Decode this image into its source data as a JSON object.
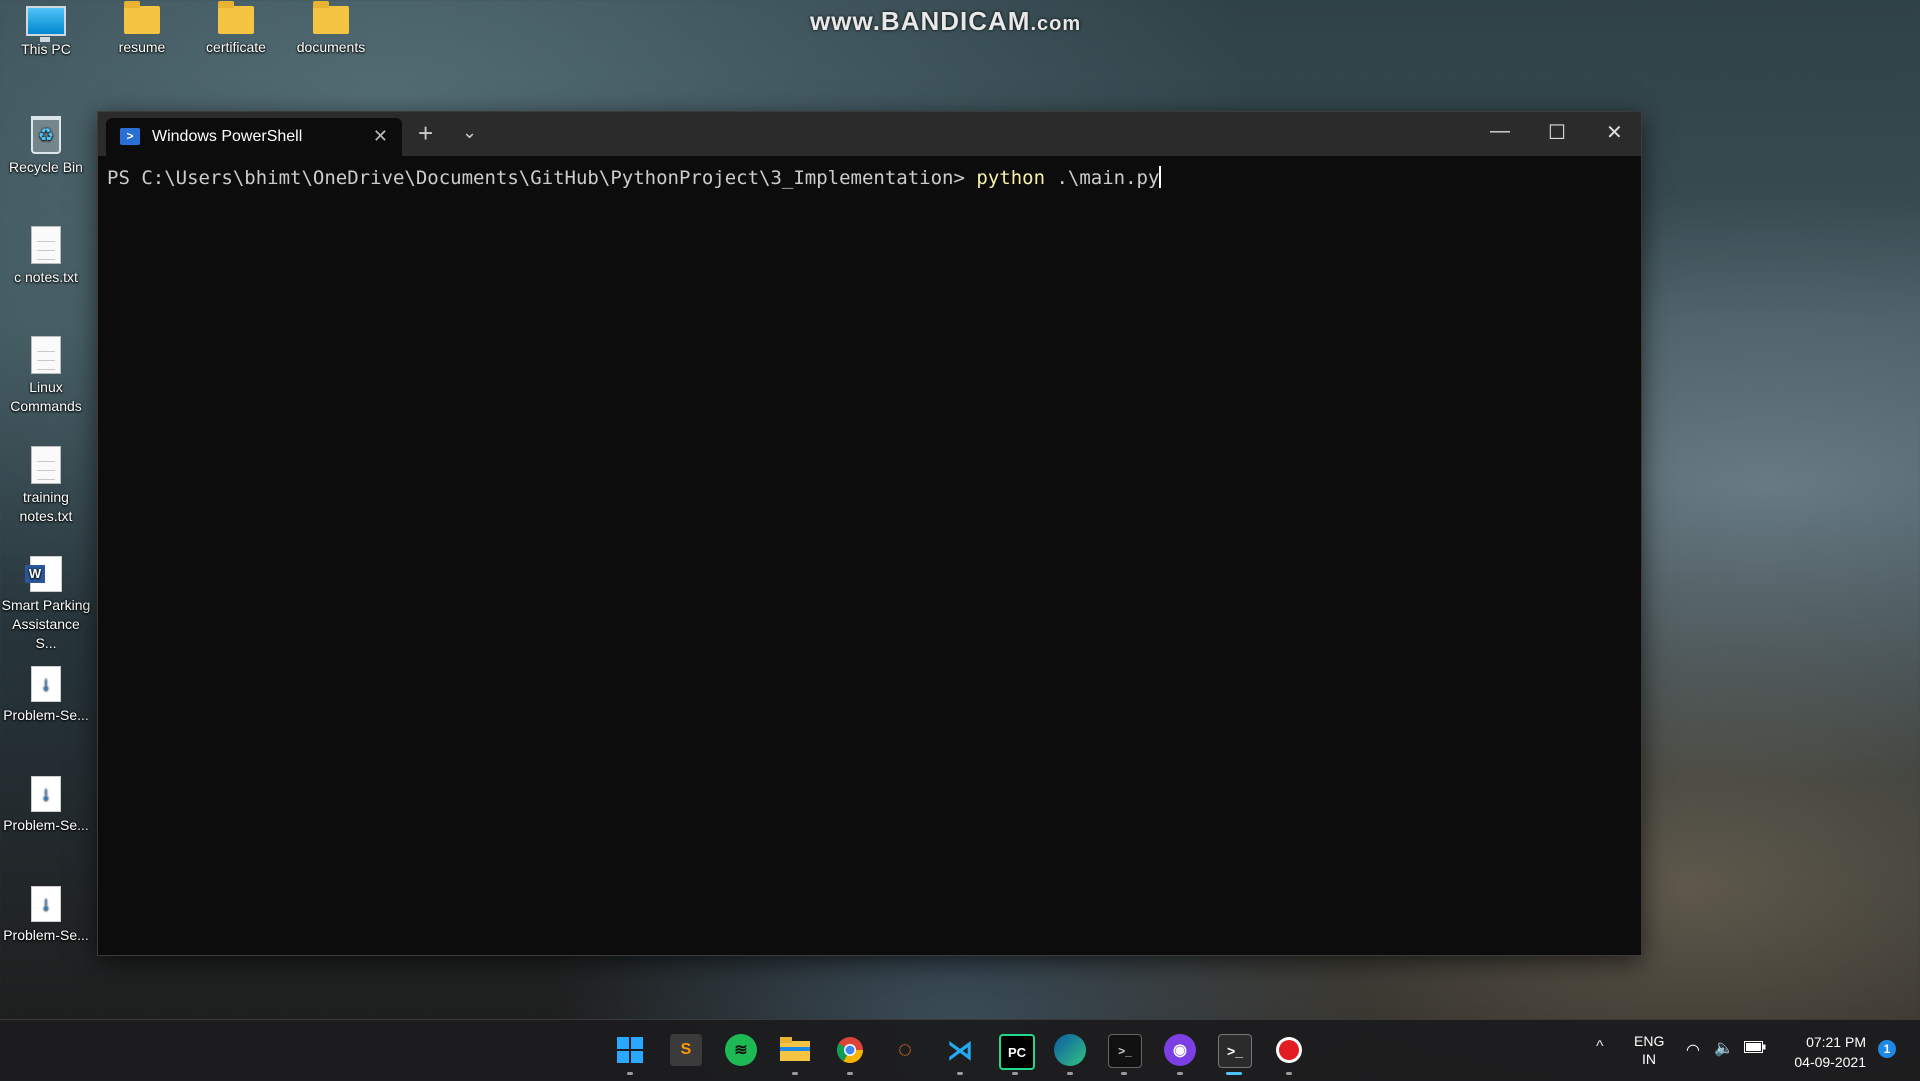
{
  "watermark": {
    "main": "www.BANDICAM",
    "suffix": ".com"
  },
  "desktop": {
    "icons": [
      {
        "label": "This PC"
      },
      {
        "label": "resume"
      },
      {
        "label": "certificate"
      },
      {
        "label": "documents"
      },
      {
        "label": "Recycle Bin"
      },
      {
        "label": "c notes.txt"
      },
      {
        "label": "Linux Commands"
      },
      {
        "label": "training notes.txt"
      },
      {
        "label": "Smart Parking Assistance S..."
      },
      {
        "label": "Problem-Se..."
      },
      {
        "label": "Problem-Se..."
      },
      {
        "label": "Problem-Se..."
      }
    ]
  },
  "window": {
    "tab_title": "Windows PowerShell",
    "tab_close": "✕",
    "new_tab": "+",
    "dropdown": "⌄",
    "minimize": "—",
    "maximize": "☐",
    "close": "✕"
  },
  "terminal": {
    "prompt": "PS C:\\Users\\bhimt\\OneDrive\\Documents\\GitHub\\PythonProject\\3_Implementation> ",
    "command": "python",
    "args": " .\\main.py"
  },
  "taskbar": {
    "apps": [
      {
        "icon": "windows-start-icon"
      },
      {
        "icon": "sublime-text-icon"
      },
      {
        "icon": "spotify-icon"
      },
      {
        "icon": "file-explorer-icon"
      },
      {
        "icon": "chrome-icon"
      },
      {
        "icon": "jupyter-icon"
      },
      {
        "icon": "vscode-icon"
      },
      {
        "icon": "pycharm-icon"
      },
      {
        "icon": "edge-icon"
      },
      {
        "icon": "command-prompt-icon"
      },
      {
        "icon": "github-desktop-icon"
      },
      {
        "icon": "windows-terminal-icon"
      },
      {
        "icon": "bandicam-record-icon"
      }
    ],
    "tray": {
      "lang_top": "ENG",
      "lang_bottom": "IN",
      "time": "07:21 PM",
      "date": "04-09-2021",
      "chevron": "^"
    }
  },
  "colors": {
    "terminal_bg": "#0c0c0c",
    "titlebar_bg": "#2b2b2b",
    "command_yellow": "#f9f1a5",
    "taskbar_accent": "#4cc2ff"
  }
}
